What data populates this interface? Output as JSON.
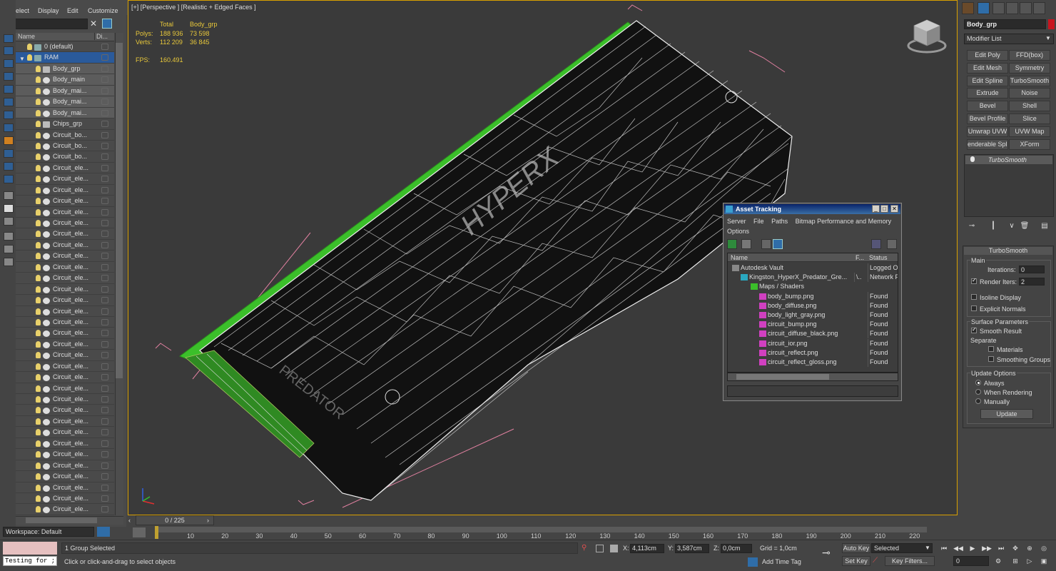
{
  "scene_explorer": {
    "menu": [
      "Select",
      "Display",
      "Edit",
      "Customize"
    ],
    "col_name": "Name",
    "col_display": "Di...",
    "rows": [
      {
        "label": "0 (default)",
        "indent": 1,
        "type": "layer"
      },
      {
        "label": "RAM",
        "indent": 1,
        "type": "layer",
        "selected": true
      },
      {
        "label": "Body_grp",
        "indent": 2,
        "type": "group",
        "sub": true
      },
      {
        "label": "Body_main",
        "indent": 2,
        "type": "object",
        "sub": true
      },
      {
        "label": "Body_mai...",
        "indent": 2,
        "type": "object",
        "sub": true
      },
      {
        "label": "Body_mai...",
        "indent": 2,
        "type": "object",
        "sub": true
      },
      {
        "label": "Body_mai...",
        "indent": 2,
        "type": "object",
        "sub": true
      },
      {
        "label": "Chips_grp",
        "indent": 2,
        "type": "group"
      },
      {
        "label": "Circuit_bo...",
        "indent": 2,
        "type": "object"
      },
      {
        "label": "Circuit_bo...",
        "indent": 2,
        "type": "object"
      },
      {
        "label": "Circuit_bo...",
        "indent": 2,
        "type": "object"
      },
      {
        "label": "Circuit_ele...",
        "indent": 2,
        "type": "object"
      },
      {
        "label": "Circuit_ele...",
        "indent": 2,
        "type": "object"
      },
      {
        "label": "Circuit_ele...",
        "indent": 2,
        "type": "object"
      },
      {
        "label": "Circuit_ele...",
        "indent": 2,
        "type": "object"
      },
      {
        "label": "Circuit_ele...",
        "indent": 2,
        "type": "object"
      },
      {
        "label": "Circuit_ele...",
        "indent": 2,
        "type": "object"
      },
      {
        "label": "Circuit_ele...",
        "indent": 2,
        "type": "object"
      },
      {
        "label": "Circuit_ele...",
        "indent": 2,
        "type": "object"
      },
      {
        "label": "Circuit_ele...",
        "indent": 2,
        "type": "object"
      },
      {
        "label": "Circuit_ele...",
        "indent": 2,
        "type": "object"
      },
      {
        "label": "Circuit_ele...",
        "indent": 2,
        "type": "object"
      },
      {
        "label": "Circuit_ele...",
        "indent": 2,
        "type": "object"
      },
      {
        "label": "Circuit_ele...",
        "indent": 2,
        "type": "object"
      },
      {
        "label": "Circuit_ele...",
        "indent": 2,
        "type": "object"
      },
      {
        "label": "Circuit_ele...",
        "indent": 2,
        "type": "object"
      },
      {
        "label": "Circuit_ele...",
        "indent": 2,
        "type": "object"
      },
      {
        "label": "Circuit_ele...",
        "indent": 2,
        "type": "object"
      },
      {
        "label": "Circuit_ele...",
        "indent": 2,
        "type": "object"
      },
      {
        "label": "Circuit_ele...",
        "indent": 2,
        "type": "object"
      },
      {
        "label": "Circuit_ele...",
        "indent": 2,
        "type": "object"
      },
      {
        "label": "Circuit_ele...",
        "indent": 2,
        "type": "object"
      },
      {
        "label": "Circuit_ele...",
        "indent": 2,
        "type": "object"
      },
      {
        "label": "Circuit_ele...",
        "indent": 2,
        "type": "object"
      },
      {
        "label": "Circuit_ele...",
        "indent": 2,
        "type": "object"
      },
      {
        "label": "Circuit_ele...",
        "indent": 2,
        "type": "object"
      },
      {
        "label": "Circuit_ele...",
        "indent": 2,
        "type": "object"
      },
      {
        "label": "Circuit_ele...",
        "indent": 2,
        "type": "object"
      },
      {
        "label": "Circuit_ele...",
        "indent": 2,
        "type": "object"
      },
      {
        "label": "Circuit_ele...",
        "indent": 2,
        "type": "object"
      },
      {
        "label": "Circuit_ele...",
        "indent": 2,
        "type": "object"
      },
      {
        "label": "Circuit_ele...",
        "indent": 2,
        "type": "object"
      },
      {
        "label": "Circuit_ele...",
        "indent": 2,
        "type": "object"
      }
    ],
    "workspace": "Workspace: Default"
  },
  "viewport": {
    "label": "[+] [Perspective ] [Realistic + Edged Faces ]",
    "stats": {
      "h_total": "Total",
      "h_obj": "Body_grp",
      "polys_label": "Polys:",
      "polys_total": "188 936",
      "polys_obj": "73 598",
      "verts_label": "Verts:",
      "verts_total": "112 209",
      "verts_obj": "36 845",
      "fps_label": "FPS:",
      "fps": "160.491"
    }
  },
  "command_panel": {
    "object_name": "Body_grp",
    "object_color": "#c8141e",
    "modifier_list": "Modifier List",
    "modifier_buttons": [
      "Edit Poly",
      "FFD(box)",
      "Edit Mesh",
      "Symmetry",
      "Edit Spline",
      "TurboSmooth",
      "Extrude",
      "Noise",
      "Bevel",
      "Shell",
      "Bevel Profile",
      "Slice",
      "Unwrap UVW",
      "UVW Map",
      "enderable Splin",
      "XForm"
    ],
    "stack_item": "TurboSmooth",
    "rollout_title": "TurboSmooth",
    "main_label": "Main",
    "iterations_label": "Iterations:",
    "iterations_value": "0",
    "render_iters_label": "Render Iters:",
    "render_iters_value": "2",
    "isoline_label": "Isoline Display",
    "explicit_normals_label": "Explicit Normals",
    "surface_label": "Surface Parameters",
    "smooth_result_label": "Smooth Result",
    "separate_label": "Separate",
    "materials_label": "Materials",
    "smoothing_groups_label": "Smoothing Groups",
    "update_options_label": "Update Options",
    "always_label": "Always",
    "when_rendering_label": "When Rendering",
    "manually_label": "Manually",
    "update_button": "Update"
  },
  "asset_tracking": {
    "title": "Asset Tracking",
    "menu": [
      "Server",
      "File",
      "Paths",
      "Bitmap Performance and Memory"
    ],
    "menu2": "Options",
    "col_name": "Name",
    "col_f": "F...",
    "col_status": "Status",
    "rows": [
      {
        "name": "Autodesk Vault",
        "f": "",
        "status": "Logged Out",
        "indent": 18,
        "icon": "vault-icon"
      },
      {
        "name": "Kingston_HyperX_Predator_Gre...",
        "f": "\\..",
        "status": "Network Pa",
        "indent": 30,
        "icon": "max-file-icon"
      },
      {
        "name": "Maps / Shaders",
        "f": "",
        "status": "",
        "indent": 44,
        "icon": "maps-icon"
      },
      {
        "name": "body_bump.png",
        "f": "",
        "status": "Found",
        "indent": 56,
        "icon": "png-icon"
      },
      {
        "name": "body_diffuse.png",
        "f": "",
        "status": "Found",
        "indent": 56,
        "icon": "png-icon"
      },
      {
        "name": "body_light_gray.png",
        "f": "",
        "status": "Found",
        "indent": 56,
        "icon": "png-icon"
      },
      {
        "name": "circuit_bump.png",
        "f": "",
        "status": "Found",
        "indent": 56,
        "icon": "png-icon"
      },
      {
        "name": "circuit_diffuse_black.png",
        "f": "",
        "status": "Found",
        "indent": 56,
        "icon": "png-icon"
      },
      {
        "name": "circuit_ior.png",
        "f": "",
        "status": "Found",
        "indent": 56,
        "icon": "png-icon"
      },
      {
        "name": "circuit_reflect.png",
        "f": "",
        "status": "Found",
        "indent": 56,
        "icon": "png-icon"
      },
      {
        "name": "circuit_reflect_gloss.png",
        "f": "",
        "status": "Found",
        "indent": 56,
        "icon": "png-icon"
      }
    ]
  },
  "timeline": {
    "slider": "0 / 225",
    "ticks": [
      "10",
      "20",
      "30",
      "40",
      "50",
      "60",
      "70",
      "80",
      "90",
      "100",
      "110",
      "120",
      "130",
      "140",
      "150",
      "160",
      "170",
      "180",
      "190",
      "200",
      "210",
      "220"
    ]
  },
  "status_bar": {
    "maxscript": "Testing for ;",
    "selection": "1 Group Selected",
    "prompt": "Click or click-and-drag to select objects",
    "x_label": "X:",
    "x_value": "4,113cm",
    "y_label": "Y:",
    "y_value": "3,587cm",
    "z_label": "Z:",
    "z_value": "0,0cm",
    "grid": "Grid = 1,0cm",
    "add_time_tag": "Add Time Tag",
    "auto_key": "Auto Key",
    "set_key": "Set Key",
    "selected": "Selected",
    "key_filters": "Key Filters...",
    "frame": "0"
  }
}
